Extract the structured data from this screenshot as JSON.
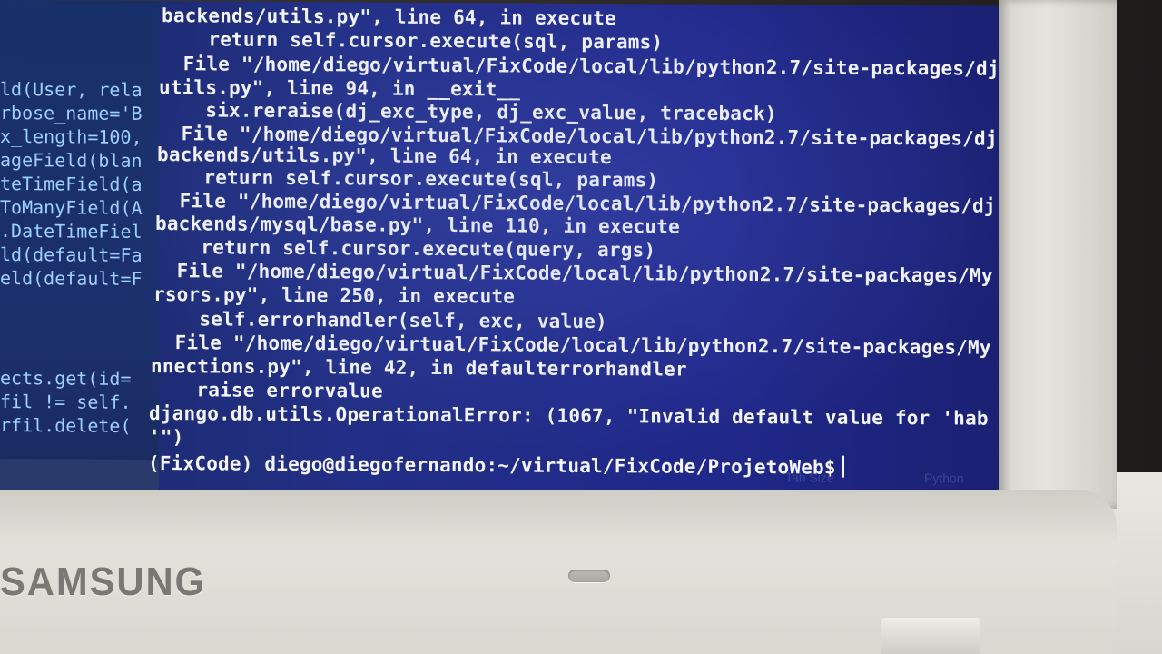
{
  "brand": "SAMSUNG",
  "editor": {
    "lines": [
      "ld(User, rela",
      "rbose_name='B",
      "x_length=100,",
      "ageField(blan",
      "teTimeField(a",
      "ToManyField(A",
      ".DateTimeFiel",
      "ld(default=Fa",
      "eld(default=F",
      "ects.get(id=",
      "fil != self.",
      "rfil.delete("
    ]
  },
  "terminal": {
    "lines": [
      "backends/utils.py\", line 64, in execute",
      "    return self.cursor.execute(sql, params)",
      "  File \"/home/diego/virtual/FixCode/local/lib/python2.7/site-packages/dj",
      "utils.py\", line 94, in __exit__",
      "    six.reraise(dj_exc_type, dj_exc_value, traceback)",
      "  File \"/home/diego/virtual/FixCode/local/lib/python2.7/site-packages/dj",
      "backends/utils.py\", line 64, in execute",
      "    return self.cursor.execute(sql, params)",
      "  File \"/home/diego/virtual/FixCode/local/lib/python2.7/site-packages/dj",
      "backends/mysql/base.py\", line 110, in execute",
      "    return self.cursor.execute(query, args)",
      "  File \"/home/diego/virtual/FixCode/local/lib/python2.7/site-packages/My",
      "rsors.py\", line 250, in execute",
      "    self.errorhandler(self, exc, value)",
      "  File \"/home/diego/virtual/FixCode/local/lib/python2.7/site-packages/My",
      "nnections.py\", line 42, in defaulterrorhandler",
      "    raise errorvalue",
      "django.db.utils.OperationalError: (1067, \"Invalid default value for 'hab",
      "'\")"
    ],
    "prompt": "(FixCode) diego@diegofernando:~/virtual/FixCode/ProjetoWeb$"
  },
  "editor_status": {
    "tab_size": "Tab Size",
    "language": "Python"
  }
}
